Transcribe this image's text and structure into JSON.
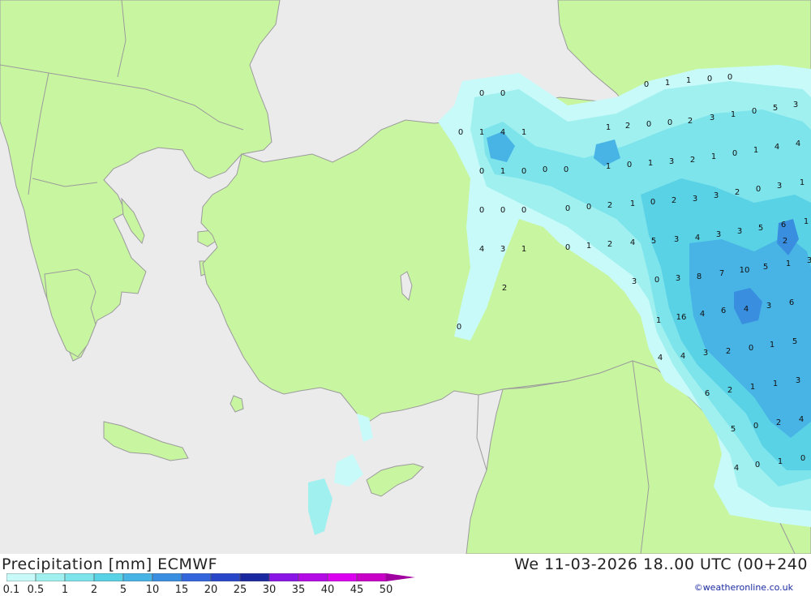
{
  "title": "Precipitation [mm] ECMWF",
  "datetime": "We 11-03-2026 18..00 UTC (00+240",
  "credit": "©weatheronline.co.uk",
  "colors": {
    "sea": "#ebebeb",
    "land": "#c8f5a0",
    "border": "#9b9b9b"
  },
  "legend": {
    "labels": [
      "0.1",
      "0.5",
      "1",
      "2",
      "5",
      "10",
      "15",
      "20",
      "25",
      "30",
      "35",
      "40",
      "45",
      "50"
    ],
    "colors": [
      "#c8fafa",
      "#a0f0f0",
      "#7de4ec",
      "#5ad2e6",
      "#48b4e6",
      "#3a8ee0",
      "#3264dc",
      "#2846c8",
      "#1a28a0",
      "#8a14e6",
      "#b40ae6",
      "#dc00f0",
      "#c800c8",
      "#a000a0"
    ]
  },
  "map_values": [
    "0",
    "0",
    "0",
    "1",
    "4",
    "1",
    "1",
    "2",
    "0",
    "0",
    "2",
    "0",
    "1",
    "1",
    "0",
    "0",
    "0",
    "1",
    "0",
    "0",
    "0",
    "0",
    "0",
    "0",
    "0",
    "0",
    "2",
    "1",
    "0",
    "1",
    "3",
    "2",
    "3",
    "1",
    "0",
    "5",
    "3",
    "1",
    "0",
    "1",
    "4",
    "4",
    "1",
    "0",
    "2",
    "3",
    "3",
    "2",
    "0",
    "3",
    "1",
    "4",
    "3",
    "1",
    "0",
    "1",
    "2",
    "4",
    "5",
    "3",
    "4",
    "3",
    "3",
    "5",
    "6",
    "1",
    "2",
    "3",
    "0",
    "3",
    "8",
    "7",
    "10",
    "5",
    "1",
    "3",
    "2",
    "1",
    "16",
    "4",
    "6",
    "4",
    "3",
    "6",
    "4",
    "4",
    "3",
    "2",
    "0",
    "1",
    "5",
    "6",
    "2",
    "1",
    "1",
    "3",
    "5",
    "0",
    "2",
    "4",
    "4",
    "0",
    "1",
    "0",
    "0"
  ]
}
